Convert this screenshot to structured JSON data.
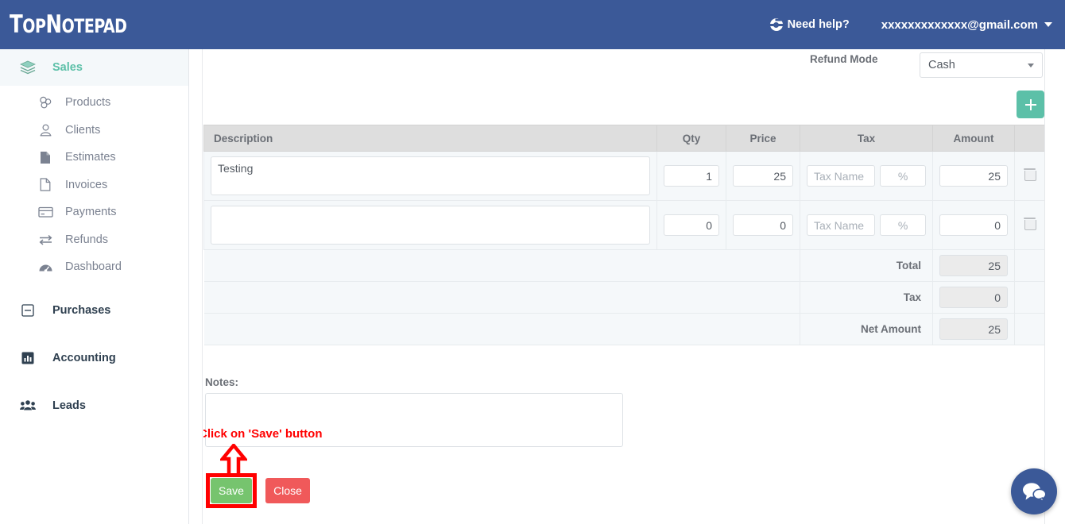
{
  "header": {
    "logo_top": "Top",
    "logo_note": "Notepad",
    "need_help": "Need help?",
    "user_email": "xxxxxxxxxxxxx@gmail.com",
    "help_icon": "lifering-icon",
    "caret_icon": "chevron-down-icon",
    "brand_color": "#3b5998"
  },
  "sidebar": {
    "groups": [
      {
        "label": "Sales",
        "icon": "layers-icon",
        "active": true,
        "items": [
          {
            "label": "Products",
            "icon": "boxes-icon"
          },
          {
            "label": "Clients",
            "icon": "user-icon"
          },
          {
            "label": "Estimates",
            "icon": "file-filled-icon"
          },
          {
            "label": "Invoices",
            "icon": "file-outline-icon"
          },
          {
            "label": "Payments",
            "icon": "credit-card-icon"
          },
          {
            "label": "Refunds",
            "icon": "exchange-arrows-icon"
          },
          {
            "label": "Dashboard",
            "icon": "gauge-icon"
          }
        ]
      },
      {
        "label": "Purchases",
        "icon": "minus-square-icon",
        "active": false,
        "items": []
      },
      {
        "label": "Accounting",
        "icon": "bar-chart-icon",
        "active": false,
        "items": []
      },
      {
        "label": "Leads",
        "icon": "users-icon",
        "active": false,
        "items": []
      }
    ],
    "active_color": "#5cc0a8"
  },
  "main": {
    "refund_mode_label": "Refund Mode",
    "refund_mode_value": "Cash",
    "add_row_button": "+",
    "add_row_color": "#5cc0a8",
    "table": {
      "headers": [
        "Description",
        "Qty",
        "Price",
        "Tax",
        "Amount",
        ""
      ],
      "rows": [
        {
          "description": "Testing",
          "qty": "1",
          "price": "25",
          "tax_name": "",
          "tax_name_placeholder": "Tax Name",
          "tax_pct": "",
          "tax_pct_placeholder": "%",
          "amount": "25",
          "delete_icon": "trash-icon"
        },
        {
          "description": "",
          "qty": "0",
          "price": "0",
          "tax_name": "",
          "tax_name_placeholder": "Tax Name",
          "tax_pct": "",
          "tax_pct_placeholder": "%",
          "amount": "0",
          "delete_icon": "trash-icon"
        }
      ],
      "totals": [
        {
          "label": "Total",
          "value": "25"
        },
        {
          "label": "Tax",
          "value": "0"
        },
        {
          "label": "Net Amount",
          "value": "25"
        }
      ]
    },
    "notes_label": "Notes:",
    "notes_value": "",
    "save_button": "Save",
    "close_button": "Close",
    "save_color": "#76c46e",
    "close_color": "#f0595a"
  },
  "annotation": {
    "text": "Click on 'Save' button",
    "color": "#ff0000",
    "arrow_icon": "up-arrow-icon",
    "highlight_target": "save-button"
  },
  "chat": {
    "icon": "chat-bubbles-icon",
    "color": "#3b5998"
  }
}
